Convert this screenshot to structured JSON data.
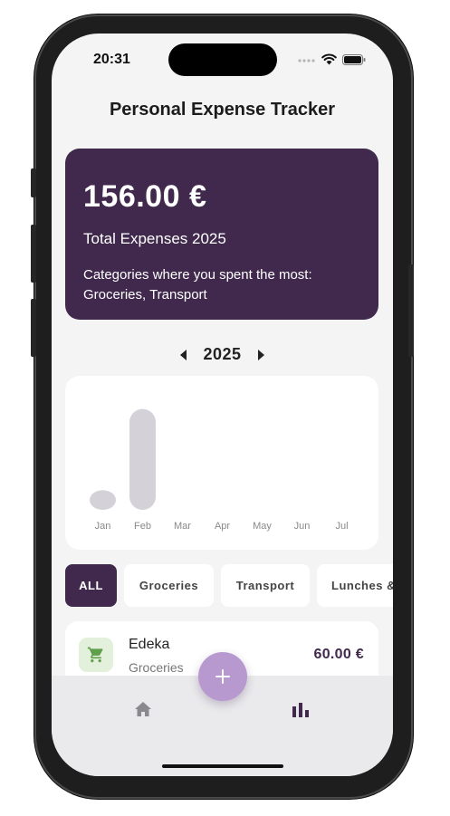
{
  "status_bar": {
    "time": "20:31",
    "icons": [
      "signal-dots-icon",
      "wifi-icon",
      "battery-icon"
    ]
  },
  "header": {
    "title": "Personal Expense Tracker"
  },
  "summary": {
    "amount": "156.00 €",
    "label": "Total Expenses 2025",
    "top_categories_text": "Categories where you spent the most: Groceries, Transport"
  },
  "year_selector": {
    "year": "2025",
    "prev_icon": "caret-left-icon",
    "next_icon": "caret-right-icon"
  },
  "chart_data": {
    "type": "bar",
    "categories": [
      "Jan",
      "Feb",
      "Mar",
      "Apr",
      "May",
      "Jun",
      "Jul"
    ],
    "values": [
      18,
      96,
      0,
      0,
      0,
      0,
      0
    ],
    "title": "",
    "xlabel": "",
    "ylabel": "",
    "ylim": [
      0,
      100
    ],
    "grid": false,
    "bar_color": "#d4d1d8"
  },
  "filters": {
    "chips": [
      {
        "label": "ALL",
        "active": true
      },
      {
        "label": "Groceries",
        "active": false
      },
      {
        "label": "Transport",
        "active": false
      },
      {
        "label": "Lunches &",
        "active": false
      }
    ]
  },
  "expenses": [
    {
      "name": "Edeka",
      "category": "Groceries",
      "amount": "60.00 €",
      "icon": "shopping-cart-icon"
    }
  ],
  "bottom_nav": {
    "items": [
      {
        "icon": "home-icon",
        "active": false
      },
      {
        "icon": "bar-chart-icon",
        "active": true
      }
    ],
    "fab_icon": "plus-icon"
  },
  "colors": {
    "primary": "#40294d",
    "fab": "#b899cf",
    "background": "#f4f4f4",
    "grocery_icon_bg": "#e3f1dc",
    "grocery_icon": "#5f9e4a"
  }
}
